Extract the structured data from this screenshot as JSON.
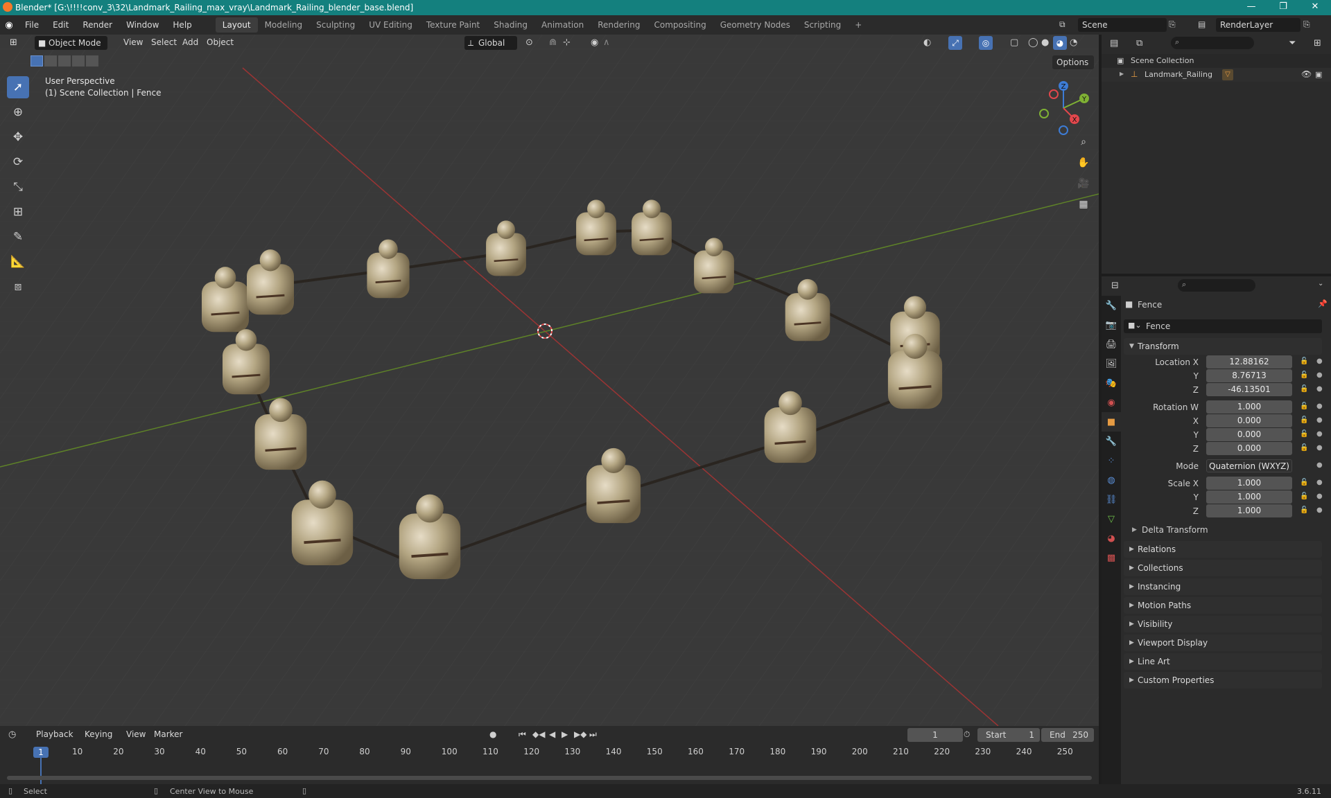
{
  "window": {
    "title": "Blender* [G:\\!!!!conv_3\\32\\Landmark_Railing_max_vray\\Landmark_Railing_blender_base.blend]",
    "minimize": "—",
    "maximize": "❐",
    "close": "✕"
  },
  "menus": [
    "File",
    "Edit",
    "Render",
    "Window",
    "Help"
  ],
  "workspaces": [
    "Layout",
    "Modeling",
    "Sculpting",
    "UV Editing",
    "Texture Paint",
    "Shading",
    "Animation",
    "Rendering",
    "Compositing",
    "Geometry Nodes",
    "Scripting",
    "+"
  ],
  "scene": {
    "name": "Scene",
    "view_layer": "RenderLayer"
  },
  "viewport": {
    "mode": "Object Mode",
    "menus": [
      "View",
      "Select",
      "Add",
      "Object"
    ],
    "orientation": "Global",
    "options": "Options",
    "perspective": "User Perspective",
    "collection_path": "(1) Scene Collection | Fence",
    "gizmo": {
      "x": "X",
      "y": "Y",
      "z": "Z"
    }
  },
  "outliner": {
    "root": "Scene Collection",
    "object": "Landmark_Railing"
  },
  "properties": {
    "object_name": "Fence",
    "data_name": "Fence",
    "transform": {
      "header": "Transform",
      "location_label": "Location X",
      "loc_x": "12.88162",
      "loc_y": "8.76713",
      "loc_z": "-46.13501",
      "rotation_label": "Rotation W",
      "rot_w": "1.000",
      "rot_x": "0.000",
      "rot_y": "0.000",
      "rot_z": "0.000",
      "mode_label": "Mode",
      "mode": "Quaternion (WXYZ)",
      "scale_label": "Scale X",
      "scale_x": "1.000",
      "scale_y": "1.000",
      "scale_z": "1.000",
      "y": "Y",
      "z": "Z",
      "x": "X",
      "delta": "Delta Transform"
    },
    "sections": [
      "Relations",
      "Collections",
      "Instancing",
      "Motion Paths",
      "Visibility",
      "Viewport Display",
      "Line Art",
      "Custom Properties"
    ]
  },
  "timeline": {
    "menus": [
      "Playback",
      "Keying",
      "View",
      "Marker"
    ],
    "current_frame": "1",
    "start_label": "Start",
    "start": "1",
    "end_label": "End",
    "end": "250",
    "ticks": [
      "1",
      "10",
      "20",
      "30",
      "40",
      "50",
      "60",
      "70",
      "80",
      "90",
      "100",
      "110",
      "120",
      "130",
      "140",
      "150",
      "160",
      "170",
      "180",
      "190",
      "200",
      "210",
      "220",
      "230",
      "240",
      "250"
    ]
  },
  "status": {
    "select": "Select",
    "center": "Center View to Mouse",
    "version": "3.6.11"
  },
  "colors": {
    "accent": "#4772b3",
    "x_axis": "#c83a3a",
    "y_axis": "#6f9a2a",
    "titlebar": "#14807e"
  }
}
